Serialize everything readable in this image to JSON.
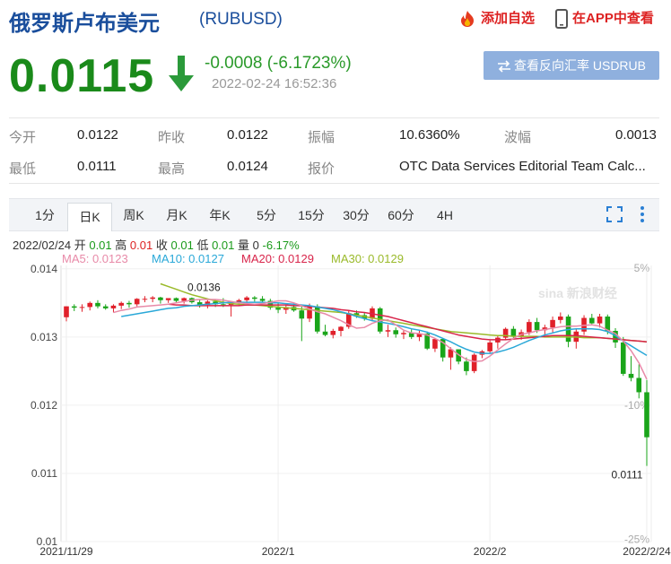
{
  "header": {
    "title": "俄罗斯卢布美元",
    "code": "(RUBUSD)",
    "add_watch": "添加自选",
    "app_view": "在APP中查看"
  },
  "quote": {
    "price": "0.0115",
    "change": "-0.0008 (-6.1723%)",
    "time": "2022-02-24 16:52:36",
    "reverse_button": "查看反向汇率 USDRUB",
    "direction": "down",
    "down_color": "#1a8a1a"
  },
  "stats": {
    "open_label": "今开",
    "open": "0.0122",
    "prev_label": "昨收",
    "prev": "0.0122",
    "amp_label": "振幅",
    "amp": "10.6360%",
    "wave_label": "波幅",
    "wave": "0.0013",
    "low_label": "最低",
    "low": "0.0111",
    "high_label": "最高",
    "high": "0.0124",
    "quote_label": "报价",
    "quote": "OTC Data Services Editorial Team Calc..."
  },
  "tabs": [
    "1分",
    "日K",
    "周K",
    "月K",
    "年K",
    "5分",
    "15分",
    "30分",
    "60分",
    "4H"
  ],
  "active_tab": "日K",
  "ohlc_line": {
    "date": "2022/02/24",
    "open_label": "开",
    "open": "0.01",
    "high_label": "高",
    "high": "0.01",
    "close_label": "收",
    "close": "0.01",
    "low_label": "低",
    "low": "0.01",
    "vol_label": "量",
    "vol": "0",
    "pct": "-6.17%"
  },
  "ma": {
    "ma5": "MA5: 0.0123",
    "ma10": "MA10: 0.0127",
    "ma20": "MA20: 0.0129",
    "ma30": "MA30: 0.0129"
  },
  "chart_data": {
    "type": "candlestick",
    "y_ticks": [
      "0.014",
      "0.013",
      "0.012",
      "0.011",
      "0.01"
    ],
    "y_tick_values": [
      0.014,
      0.013,
      0.012,
      0.011,
      0.01
    ],
    "right_ticks": [
      "5%",
      "-10%",
      "-25%"
    ],
    "x_ticks": [
      "2021/11/29",
      "2022/1",
      "2022/2",
      "2022/2/24"
    ],
    "ylim": [
      0.01,
      0.01405
    ],
    "max_label": "0.0136",
    "min_label": "0.0111",
    "up_color": "#e0202a",
    "down_color": "#1aa51a",
    "candles": [
      {
        "o": 0.01329,
        "h": 0.01345,
        "l": 0.01323,
        "c": 0.01345
      },
      {
        "o": 0.01345,
        "h": 0.01348,
        "l": 0.01338,
        "c": 0.01343
      },
      {
        "o": 0.01343,
        "h": 0.01348,
        "l": 0.01337,
        "c": 0.01344
      },
      {
        "o": 0.01344,
        "h": 0.01352,
        "l": 0.01339,
        "c": 0.0135
      },
      {
        "o": 0.0135,
        "h": 0.01354,
        "l": 0.01342,
        "c": 0.01345
      },
      {
        "o": 0.01345,
        "h": 0.01348,
        "l": 0.0134,
        "c": 0.01342
      },
      {
        "o": 0.01342,
        "h": 0.01348,
        "l": 0.01336,
        "c": 0.01346
      },
      {
        "o": 0.01346,
        "h": 0.01352,
        "l": 0.01341,
        "c": 0.0135
      },
      {
        "o": 0.0135,
        "h": 0.01353,
        "l": 0.01343,
        "c": 0.01348
      },
      {
        "o": 0.01348,
        "h": 0.01357,
        "l": 0.01345,
        "c": 0.01356
      },
      {
        "o": 0.01356,
        "h": 0.0136,
        "l": 0.01351,
        "c": 0.01356
      },
      {
        "o": 0.01356,
        "h": 0.0136,
        "l": 0.01351,
        "c": 0.01358
      },
      {
        "o": 0.01358,
        "h": 0.01359,
        "l": 0.01349,
        "c": 0.01354
      },
      {
        "o": 0.01354,
        "h": 0.01357,
        "l": 0.0135,
        "c": 0.01357
      },
      {
        "o": 0.01357,
        "h": 0.01358,
        "l": 0.01351,
        "c": 0.01353
      },
      {
        "o": 0.01353,
        "h": 0.01358,
        "l": 0.01349,
        "c": 0.01357
      },
      {
        "o": 0.01357,
        "h": 0.01358,
        "l": 0.01349,
        "c": 0.01351
      },
      {
        "o": 0.01351,
        "h": 0.01355,
        "l": 0.01343,
        "c": 0.01347
      },
      {
        "o": 0.01347,
        "h": 0.01354,
        "l": 0.01342,
        "c": 0.01352
      },
      {
        "o": 0.01352,
        "h": 0.01355,
        "l": 0.01344,
        "c": 0.01348
      },
      {
        "o": 0.01348,
        "h": 0.01357,
        "l": 0.01344,
        "c": 0.01347
      },
      {
        "o": 0.01347,
        "h": 0.01352,
        "l": 0.0133,
        "c": 0.01351
      },
      {
        "o": 0.01351,
        "h": 0.01356,
        "l": 0.01346,
        "c": 0.01354
      },
      {
        "o": 0.01354,
        "h": 0.0136,
        "l": 0.0135,
        "c": 0.01358
      },
      {
        "o": 0.01358,
        "h": 0.0136,
        "l": 0.01352,
        "c": 0.01356
      },
      {
        "o": 0.01356,
        "h": 0.0136,
        "l": 0.01351,
        "c": 0.01353
      },
      {
        "o": 0.01353,
        "h": 0.01356,
        "l": 0.0134,
        "c": 0.01343
      },
      {
        "o": 0.01343,
        "h": 0.0135,
        "l": 0.01335,
        "c": 0.0134
      },
      {
        "o": 0.0134,
        "h": 0.01348,
        "l": 0.01334,
        "c": 0.01344
      },
      {
        "o": 0.01344,
        "h": 0.01349,
        "l": 0.01337,
        "c": 0.01339
      },
      {
        "o": 0.01339,
        "h": 0.01345,
        "l": 0.01294,
        "c": 0.01327
      },
      {
        "o": 0.01327,
        "h": 0.01349,
        "l": 0.01322,
        "c": 0.01345
      },
      {
        "o": 0.01345,
        "h": 0.01348,
        "l": 0.01305,
        "c": 0.01308
      },
      {
        "o": 0.01308,
        "h": 0.01318,
        "l": 0.01301,
        "c": 0.01303
      },
      {
        "o": 0.01303,
        "h": 0.01312,
        "l": 0.01298,
        "c": 0.01309
      },
      {
        "o": 0.01309,
        "h": 0.01316,
        "l": 0.01301,
        "c": 0.01315
      },
      {
        "o": 0.01315,
        "h": 0.01338,
        "l": 0.01312,
        "c": 0.01335
      },
      {
        "o": 0.01335,
        "h": 0.01339,
        "l": 0.01328,
        "c": 0.01332
      },
      {
        "o": 0.01332,
        "h": 0.01336,
        "l": 0.01324,
        "c": 0.01327
      },
      {
        "o": 0.01327,
        "h": 0.01345,
        "l": 0.01323,
        "c": 0.01342
      },
      {
        "o": 0.01342,
        "h": 0.01344,
        "l": 0.01305,
        "c": 0.01308
      },
      {
        "o": 0.01308,
        "h": 0.01318,
        "l": 0.013,
        "c": 0.0131
      },
      {
        "o": 0.0131,
        "h": 0.01314,
        "l": 0.01299,
        "c": 0.01304
      },
      {
        "o": 0.01304,
        "h": 0.0131,
        "l": 0.01297,
        "c": 0.01306
      },
      {
        "o": 0.01306,
        "h": 0.01311,
        "l": 0.01297,
        "c": 0.013
      },
      {
        "o": 0.013,
        "h": 0.0131,
        "l": 0.01294,
        "c": 0.01305
      },
      {
        "o": 0.01305,
        "h": 0.01308,
        "l": 0.01281,
        "c": 0.01283
      },
      {
        "o": 0.01283,
        "h": 0.01298,
        "l": 0.01278,
        "c": 0.01297
      },
      {
        "o": 0.01297,
        "h": 0.01298,
        "l": 0.01264,
        "c": 0.0127
      },
      {
        "o": 0.0127,
        "h": 0.01285,
        "l": 0.01252,
        "c": 0.01282
      },
      {
        "o": 0.01282,
        "h": 0.01282,
        "l": 0.0126,
        "c": 0.01264
      },
      {
        "o": 0.01264,
        "h": 0.0127,
        "l": 0.01244,
        "c": 0.0125
      },
      {
        "o": 0.0125,
        "h": 0.01276,
        "l": 0.01247,
        "c": 0.01274
      },
      {
        "o": 0.01274,
        "h": 0.01281,
        "l": 0.01269,
        "c": 0.01279
      },
      {
        "o": 0.01279,
        "h": 0.01295,
        "l": 0.01276,
        "c": 0.01292
      },
      {
        "o": 0.01292,
        "h": 0.01302,
        "l": 0.01283,
        "c": 0.01299
      },
      {
        "o": 0.01299,
        "h": 0.01314,
        "l": 0.01296,
        "c": 0.01312
      },
      {
        "o": 0.01312,
        "h": 0.01316,
        "l": 0.01297,
        "c": 0.01301
      },
      {
        "o": 0.01301,
        "h": 0.01311,
        "l": 0.01296,
        "c": 0.01307
      },
      {
        "o": 0.01307,
        "h": 0.01326,
        "l": 0.01303,
        "c": 0.01322
      },
      {
        "o": 0.01322,
        "h": 0.01328,
        "l": 0.01306,
        "c": 0.0131
      },
      {
        "o": 0.0131,
        "h": 0.01318,
        "l": 0.01302,
        "c": 0.01314
      },
      {
        "o": 0.01314,
        "h": 0.0133,
        "l": 0.01307,
        "c": 0.01325
      },
      {
        "o": 0.01325,
        "h": 0.01336,
        "l": 0.0132,
        "c": 0.0133
      },
      {
        "o": 0.0133,
        "h": 0.01333,
        "l": 0.01285,
        "c": 0.01293
      },
      {
        "o": 0.01293,
        "h": 0.01311,
        "l": 0.01283,
        "c": 0.01308
      },
      {
        "o": 0.01308,
        "h": 0.01332,
        "l": 0.01303,
        "c": 0.01328
      },
      {
        "o": 0.01328,
        "h": 0.01334,
        "l": 0.01319,
        "c": 0.0132
      },
      {
        "o": 0.0132,
        "h": 0.01334,
        "l": 0.01314,
        "c": 0.0133
      },
      {
        "o": 0.0133,
        "h": 0.01333,
        "l": 0.01304,
        "c": 0.01309
      },
      {
        "o": 0.01309,
        "h": 0.01313,
        "l": 0.01284,
        "c": 0.01292
      },
      {
        "o": 0.01292,
        "h": 0.013,
        "l": 0.01243,
        "c": 0.01246
      },
      {
        "o": 0.01246,
        "h": 0.01272,
        "l": 0.01235,
        "c": 0.0124
      },
      {
        "o": 0.0124,
        "h": 0.0126,
        "l": 0.0121,
        "c": 0.01219
      },
      {
        "o": 0.01219,
        "h": 0.01237,
        "l": 0.01111,
        "c": 0.01153
      }
    ],
    "ma5": [
      0.01336,
      0.01339,
      0.01341,
      0.01344,
      0.01345,
      0.01346,
      0.01347,
      0.01348,
      0.0135,
      0.01352,
      0.01354,
      0.01355,
      0.01355,
      0.01355,
      0.01354,
      0.01352,
      0.0135,
      0.01349,
      0.01348,
      0.01349,
      0.01351,
      0.01353,
      0.01353,
      0.0135,
      0.01346,
      0.01341,
      0.01337,
      0.01334,
      0.01329,
      0.01324,
      0.01318,
      0.01313,
      0.01314,
      0.0132,
      0.01324,
      0.01325,
      0.01318,
      0.0131,
      0.01306,
      0.01305,
      0.01303,
      0.01298,
      0.01292,
      0.01283,
      0.01274,
      0.01267,
      0.01264,
      0.01265,
      0.01272,
      0.01281,
      0.0129,
      0.01298,
      0.01304,
      0.01306,
      0.01309,
      0.01311,
      0.01313,
      0.01315,
      0.01316,
      0.01316,
      0.01317,
      0.01318,
      0.01316,
      0.0131,
      0.01305,
      0.01294,
      0.0128,
      0.01262,
      0.01238
    ],
    "ma10": [
      0.0133,
      0.01332,
      0.01334,
      0.01336,
      0.01338,
      0.0134,
      0.01342,
      0.01343,
      0.01345,
      0.01346,
      0.01347,
      0.01348,
      0.01349,
      0.0135,
      0.01351,
      0.01351,
      0.01351,
      0.01351,
      0.01351,
      0.0135,
      0.0135,
      0.01349,
      0.01348,
      0.01347,
      0.01346,
      0.01344,
      0.01342,
      0.0134,
      0.01337,
      0.01334,
      0.0133,
      0.01327,
      0.01324,
      0.01322,
      0.0132,
      0.01318,
      0.01315,
      0.01312,
      0.0131,
      0.01307,
      0.01303,
      0.01298,
      0.01293,
      0.01287,
      0.01282,
      0.01278,
      0.01276,
      0.01276,
      0.01278,
      0.01281,
      0.01285,
      0.0129,
      0.01295,
      0.01299,
      0.01303,
      0.01306,
      0.01309,
      0.01311,
      0.01312,
      0.01312,
      0.01312,
      0.01311,
      0.01308,
      0.01302,
      0.01294,
      0.01287,
      0.0128,
      0.01273
    ],
    "ma20": [
      0.01348,
      0.01347,
      0.01347,
      0.01346,
      0.01346,
      0.01346,
      0.01346,
      0.01346,
      0.01346,
      0.01346,
      0.01347,
      0.01347,
      0.01347,
      0.01347,
      0.01347,
      0.01347,
      0.01346,
      0.01346,
      0.01345,
      0.01344,
      0.01343,
      0.01342,
      0.0134,
      0.01339,
      0.01337,
      0.01336,
      0.01334,
      0.01332,
      0.0133,
      0.01327,
      0.01324,
      0.01321,
      0.01318,
      0.01315,
      0.01312,
      0.01309,
      0.01306,
      0.01303,
      0.01301,
      0.01299,
      0.01297,
      0.01296,
      0.01296,
      0.01296,
      0.01297,
      0.01298,
      0.01299,
      0.013,
      0.01301,
      0.01302,
      0.01302,
      0.01302,
      0.01302,
      0.01301,
      0.013,
      0.01299,
      0.01298,
      0.01297,
      0.01296,
      0.01295,
      0.01294,
      0.01293
    ],
    "ma30": [
      0.01378,
      0.01374,
      0.0137,
      0.01366,
      0.01362,
      0.01359,
      0.01356,
      0.01353,
      0.01351,
      0.01349,
      0.01348,
      0.01347,
      0.01347,
      0.01346,
      0.01345,
      0.01344,
      0.01343,
      0.01342,
      0.01341,
      0.0134,
      0.01339,
      0.01338,
      0.01337,
      0.01336,
      0.01334,
      0.01332,
      0.0133,
      0.01328,
      0.01326,
      0.01324,
      0.01322,
      0.0132,
      0.01318,
      0.01316,
      0.01314,
      0.01312,
      0.0131,
      0.01308,
      0.01307,
      0.01306,
      0.01305,
      0.01304,
      0.01303,
      0.01302,
      0.01302,
      0.01301,
      0.01301,
      0.01301,
      0.01301,
      0.013,
      0.013,
      0.013,
      0.013,
      0.013,
      0.01299,
      0.01299,
      0.01299,
      0.01298,
      0.01297,
      0.01296,
      0.01295,
      0.01294,
      0.01293
    ],
    "ma_colors": {
      "ma5": "#e88aa8",
      "ma10": "#2aa8d8",
      "ma20": "#d8244a",
      "ma30": "#9aba2a"
    }
  }
}
